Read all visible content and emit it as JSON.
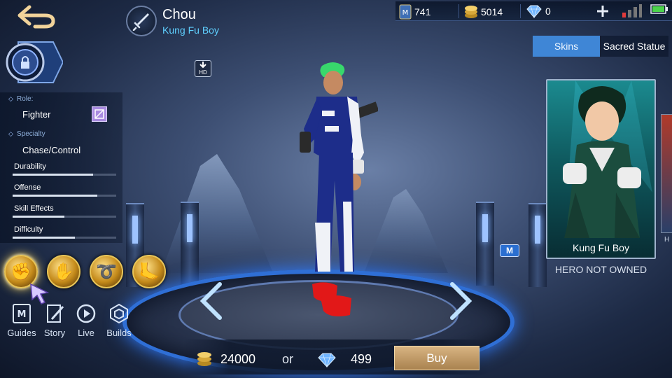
{
  "header": {
    "hero_name": "Chou",
    "hero_title": "Kung Fu Boy",
    "role_icon": "sword-icon",
    "back_icon": "back-arrow-icon"
  },
  "resources": {
    "tickets": "741",
    "gold": "5014",
    "diamonds": "0",
    "add_icon": "plus-icon",
    "signal_icon": "signal-icon",
    "battery_icon": "battery-icon"
  },
  "info": {
    "role_label": "Role:",
    "role_value": "Fighter",
    "specialty_label": "Specialty",
    "specialty_value": "Chase/Control",
    "stats": [
      {
        "label": "Durability",
        "value": 0.78
      },
      {
        "label": "Offense",
        "value": 0.82
      },
      {
        "label": "Skill Effects",
        "value": 0.5
      },
      {
        "label": "Difficulty",
        "value": 0.6
      }
    ]
  },
  "skills": [
    {
      "icon": "skill-1-icon",
      "glyph": "✊"
    },
    {
      "icon": "skill-2-icon",
      "glyph": "✋"
    },
    {
      "icon": "skill-3-icon",
      "glyph": "➰"
    },
    {
      "icon": "skill-4-icon",
      "glyph": "🦶"
    }
  ],
  "nav": [
    {
      "label": "Guides",
      "icon": "guides-icon"
    },
    {
      "label": "Story",
      "icon": "story-icon"
    },
    {
      "label": "Live",
      "icon": "live-icon"
    },
    {
      "label": "Builds",
      "icon": "builds-icon"
    }
  ],
  "tabs": {
    "skins": "Skins",
    "statue": "Sacred Statue"
  },
  "skin_card": {
    "name": "Kung Fu Boy",
    "next_label": "H"
  },
  "m_badge": "M",
  "status": "HERO NOT OWNED",
  "purchase": {
    "gold_price": "24000",
    "or": "or",
    "diamond_price": "499",
    "buy_label": "Buy"
  },
  "colors": {
    "accent_blue": "#3f86d6",
    "title_cyan": "#5fd0ff",
    "gold": "#e7c458",
    "buy_button": "#c09a66"
  }
}
